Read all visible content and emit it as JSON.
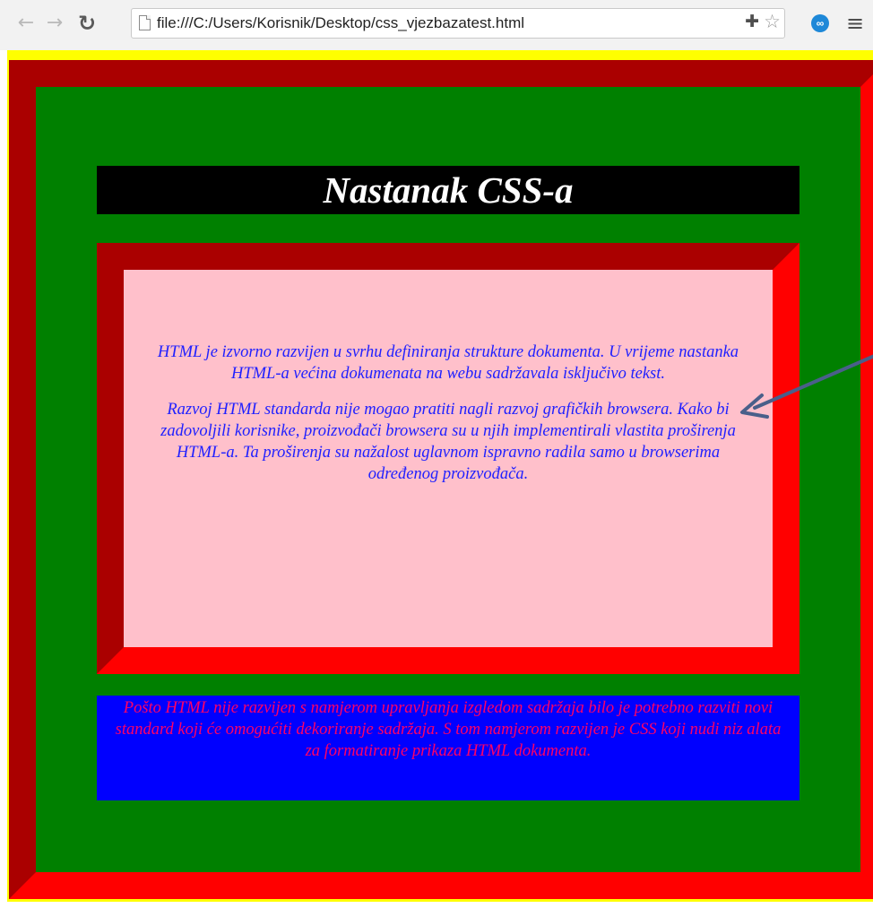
{
  "browser": {
    "url": "file:///C:/Users/Korisnik/Desktop/css_vjezbazatest.html",
    "back_icon": "back-arrow-icon",
    "forward_icon": "forward-arrow-icon",
    "reload_icon": "reload-icon",
    "extension_badge": "∞"
  },
  "page": {
    "title": "Nastanak CSS-a",
    "paragraph_1": "HTML je izvorno razvijen u svrhu definiranja strukture dokumenta. U vrijeme nastanka HTML-a većina dokumenata na webu sadržavala isključivo tekst.",
    "paragraph_2": "Razvoj HTML standarda nije mogao pratiti nagli razvoj grafičkih browsera. Kako bi zadovoljili korisnike, proizvođači browsera su u njih implementirali vlastita proširenja HTML-a. Ta proširenja su nažalost uglavnom ispravno radila samo u browserima određenog proizvođača.",
    "blue_paragraph": "Pošto HTML nije razvijen s namjerom upravljanja izgledom sadržaja bilo je potrebno razviti novi standard koji će omogućiti dekoriranje sadržaja. S tom namjerom razvijen je CSS koji nudi niz alata za formatiranje prikaza HTML dokumenta."
  },
  "colors": {
    "outer_background": "#ffff00",
    "frame_dark": "#aa0000",
    "frame_light": "#ff0000",
    "green": "#008000",
    "pink": "#ffc0cb",
    "blue": "#0000ff",
    "paragraph_text": "#2020ff",
    "blue_box_text": "#ff0066",
    "arrow": "#4a5f8a"
  }
}
